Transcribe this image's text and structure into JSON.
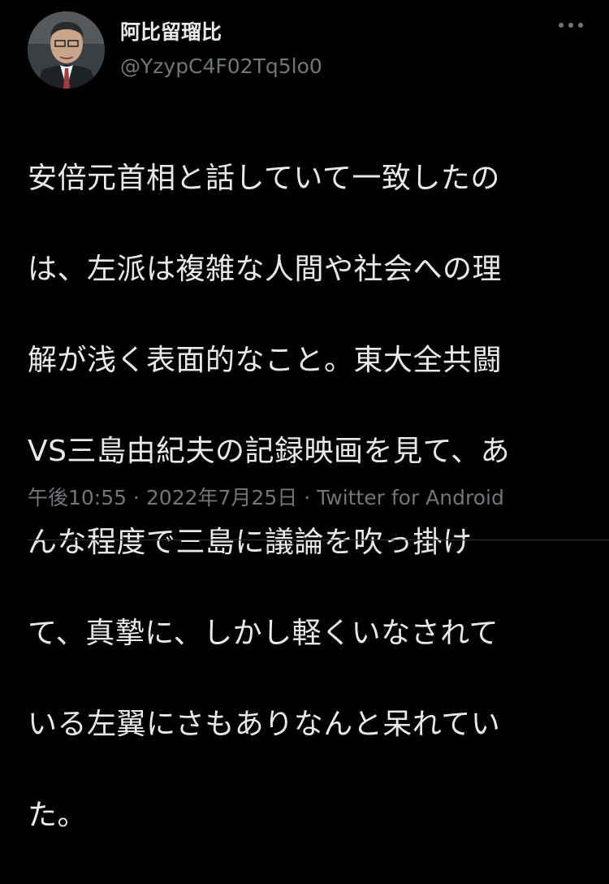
{
  "tweet": {
    "author": {
      "display_name": "阿比留瑠比",
      "handle": "@YzypC4F02Tq5lo0"
    },
    "body_lines": [
      "安倍元首相と話していて一致したの",
      "は、左派は複雑な人間や社会への理",
      "解が浅く表面的なこと。東大全共闘",
      "VS三島由紀夫の記録映画を見て、あ",
      "んな程度で三島に議論を吹っ掛け",
      "て、真摯に、しかし軽くいなされて",
      "いる左翼にさもありなんと呆れてい",
      "た。"
    ],
    "time": "午後10:55",
    "separator": "·",
    "date": "2022年7月25日",
    "client": "Twitter for Android"
  },
  "icons": {
    "avatar": "avatar-photo",
    "more": "more-options-icon"
  },
  "colors": {
    "background": "#000000",
    "text": "#e7e9ea",
    "secondary": "#71767b",
    "divider": "#2f3336"
  }
}
